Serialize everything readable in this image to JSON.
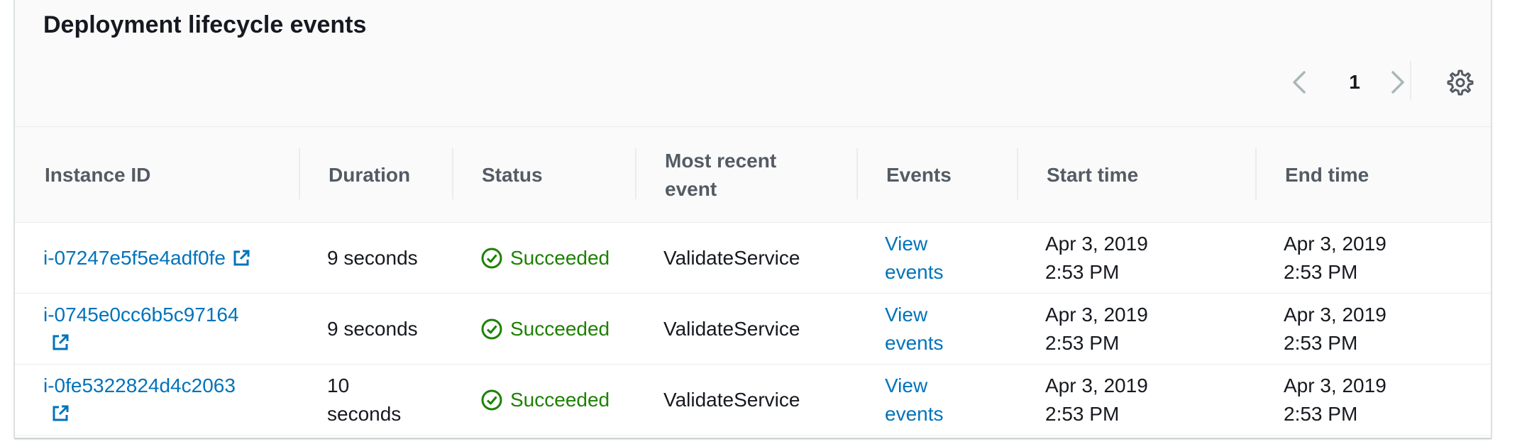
{
  "panel": {
    "title": "Deployment lifecycle events"
  },
  "pagination": {
    "current_page": "1"
  },
  "icons": {
    "prev": "chevron-left-icon",
    "next": "chevron-right-icon",
    "settings": "gear-icon",
    "external": "external-link-icon",
    "status": "check-circle-icon"
  },
  "colors": {
    "link": "#0073bb",
    "success": "#1d8102",
    "header_bg": "#fafafa"
  },
  "table": {
    "columns": [
      "Instance ID",
      "Duration",
      "Status",
      "Most recent event",
      "Events",
      "Start time",
      "End time"
    ],
    "rows": [
      {
        "instance_id_line1": "i-07247e5f5e4adf0fe",
        "instance_id_line2": "",
        "duration_line1": "9 seconds",
        "duration_line2": "",
        "status": "Succeeded",
        "most_recent_event": "ValidateService",
        "events_line1": "View",
        "events_line2": "events",
        "start_date": "Apr 3, 2019",
        "start_time": "2:53 PM",
        "end_date": "Apr 3, 2019",
        "end_time": "2:53 PM"
      },
      {
        "instance_id_line1": "i-0745e0cc6b5c97164",
        "instance_id_line2": "",
        "duration_line1": "9 seconds",
        "duration_line2": "",
        "status": "Succeeded",
        "most_recent_event": "ValidateService",
        "events_line1": "View",
        "events_line2": "events",
        "start_date": "Apr 3, 2019",
        "start_time": "2:53 PM",
        "end_date": "Apr 3, 2019",
        "end_time": "2:53 PM"
      },
      {
        "instance_id_line1": "i-0fe5322824d4c2063",
        "instance_id_line2": "",
        "duration_line1": "10",
        "duration_line2": "seconds",
        "status": "Succeeded",
        "most_recent_event": "ValidateService",
        "events_line1": "View",
        "events_line2": "events",
        "start_date": "Apr 3, 2019",
        "start_time": "2:53 PM",
        "end_date": "Apr 3, 2019",
        "end_time": "2:53 PM"
      }
    ]
  }
}
